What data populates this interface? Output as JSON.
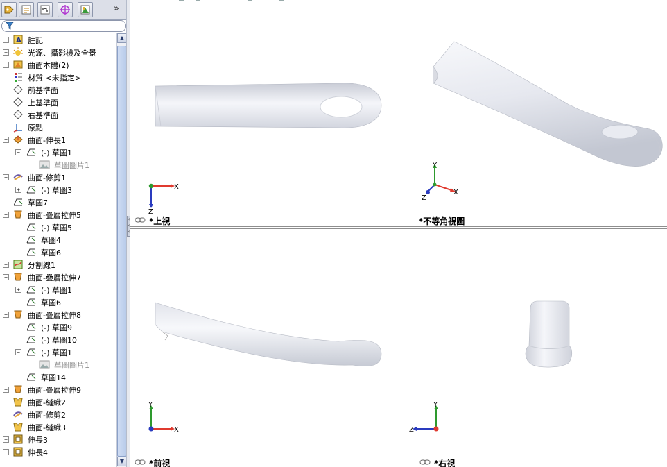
{
  "feature_tree": {
    "tabs": [
      "feature-manager-icon",
      "property-manager-icon",
      "configuration-manager-icon",
      "dimxpert-icon",
      "display-manager-icon"
    ],
    "more_label": "»",
    "items": [
      {
        "label": "註記",
        "icon": "annotations-icon"
      },
      {
        "label": "光源、攝影機及全景",
        "icon": "lights-icon"
      },
      {
        "label": "曲面本體(2)",
        "icon": "surface-bodies-icon"
      },
      {
        "label": "材質 <未指定>",
        "icon": "material-icon"
      },
      {
        "label": "前基準面",
        "icon": "plane-icon"
      },
      {
        "label": "上基準面",
        "icon": "plane-icon"
      },
      {
        "label": "右基準面",
        "icon": "plane-icon"
      },
      {
        "label": "原點",
        "icon": "origin-icon"
      },
      {
        "label": "曲面-伸長1",
        "icon": "surface-extrude-icon"
      },
      {
        "label": "(-) 草圖1",
        "icon": "sketch-icon"
      },
      {
        "label": "草圖圖片1",
        "icon": "sketch-picture-icon"
      },
      {
        "label": "曲面-修剪1",
        "icon": "surface-trim-icon"
      },
      {
        "label": "(-) 草圖3",
        "icon": "sketch-icon"
      },
      {
        "label": "草圖7",
        "icon": "sketch-icon"
      },
      {
        "label": "曲面-疊層拉伸5",
        "icon": "surface-loft-icon"
      },
      {
        "label": "(-) 草圖5",
        "icon": "sketch-icon"
      },
      {
        "label": "草圖4",
        "icon": "sketch-icon"
      },
      {
        "label": "草圖6",
        "icon": "sketch-icon"
      },
      {
        "label": "分割線1",
        "icon": "split-line-icon"
      },
      {
        "label": "曲面-疊層拉伸7",
        "icon": "surface-loft-icon"
      },
      {
        "label": "(-) 草圖1",
        "icon": "sketch-icon"
      },
      {
        "label": "草圖6",
        "icon": "sketch-icon"
      },
      {
        "label": "曲面-疊層拉伸8",
        "icon": "surface-loft-icon"
      },
      {
        "label": "(-) 草圖9",
        "icon": "sketch-icon"
      },
      {
        "label": "(-) 草圖10",
        "icon": "sketch-icon"
      },
      {
        "label": "(-) 草圖1",
        "icon": "sketch-icon"
      },
      {
        "label": "草圖圖片1",
        "icon": "sketch-picture-icon"
      },
      {
        "label": "草圖14",
        "icon": "sketch-icon"
      },
      {
        "label": "曲面-疊層拉伸9",
        "icon": "surface-loft-icon"
      },
      {
        "label": "曲面-縫織2",
        "icon": "surface-knit-icon"
      },
      {
        "label": "曲面-修剪2",
        "icon": "surface-trim-icon"
      },
      {
        "label": "曲面-縫織3",
        "icon": "surface-knit-icon"
      },
      {
        "label": "伸長3",
        "icon": "extrude-icon"
      },
      {
        "label": "伸長4",
        "icon": "extrude-icon"
      }
    ]
  },
  "viewports": {
    "top": {
      "label": "*上視",
      "axis_x": "X",
      "axis_z": "Z"
    },
    "iso": {
      "label": "*不等角視圖",
      "axis_x": "X",
      "axis_y": "Y",
      "axis_z": "Z"
    },
    "front": {
      "label": "*前視",
      "axis_x": "X",
      "axis_y": "Y"
    },
    "right": {
      "label": "*右視",
      "axis_y": "Y",
      "axis_z": "Z"
    }
  },
  "colors": {
    "axis_x": "#e03a2f",
    "axis_y": "#2e9a2e",
    "axis_z": "#2a3bbf",
    "model": "#e6e8ef",
    "tree_bg": "#ffffff"
  }
}
